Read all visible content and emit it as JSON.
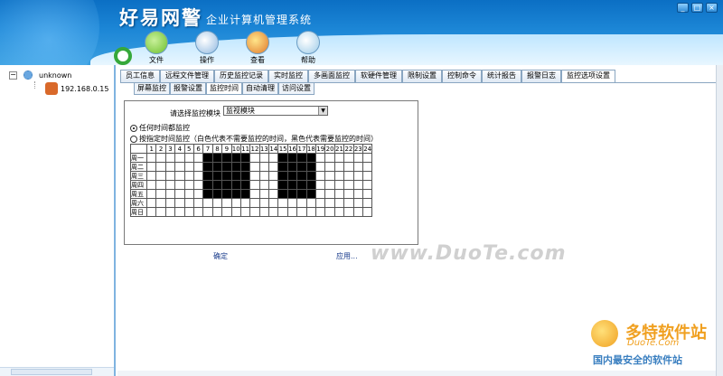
{
  "app": {
    "brand": "好易网警",
    "subtitle": "企业计算机管理系统",
    "window_buttons": [
      "_",
      "□",
      "×"
    ]
  },
  "toolbar": [
    {
      "label": "文件",
      "icon": "file-icon"
    },
    {
      "label": "操作",
      "icon": "operate-icon"
    },
    {
      "label": "查看",
      "icon": "view-icon"
    },
    {
      "label": "帮助",
      "icon": "help-icon"
    }
  ],
  "tree": {
    "root_label": "unknown",
    "child_label": "192.168.0.15",
    "expander": "−"
  },
  "tabs": [
    {
      "label": "员工信息",
      "active": false
    },
    {
      "label": "远程文件管理",
      "active": false
    },
    {
      "label": "历史监控记录",
      "active": false
    },
    {
      "label": "实时监控",
      "active": false
    },
    {
      "label": "多画面监控",
      "active": false
    },
    {
      "label": "软硬件管理",
      "active": false
    },
    {
      "label": "限制设置",
      "active": false
    },
    {
      "label": "控制命令",
      "active": false
    },
    {
      "label": "统计报告",
      "active": false
    },
    {
      "label": "报警日志",
      "active": false
    },
    {
      "label": "监控选项设置",
      "active": true
    }
  ],
  "subtabs": [
    {
      "label": "屏幕监控",
      "active": false
    },
    {
      "label": "报警设置",
      "active": false
    },
    {
      "label": "监控时间",
      "active": true
    },
    {
      "label": "自动清理",
      "active": false
    },
    {
      "label": "访问设置",
      "active": false
    }
  ],
  "panel": {
    "select_label": "请选择监控模块",
    "select_value": "监视模块",
    "radio_all": "任何时间都监控",
    "radio_scheduled": "按指定时间监控（白色代表不需要监控的时间，黑色代表需要监控的时间）",
    "radio_all_selected": true
  },
  "schedule": {
    "hours": [
      "1",
      "2",
      "3",
      "4",
      "5",
      "6",
      "7",
      "8",
      "9",
      "10",
      "11",
      "12",
      "13",
      "14",
      "15",
      "16",
      "17",
      "18",
      "19",
      "20",
      "21",
      "22",
      "23",
      "24"
    ],
    "days": [
      "周一",
      "周二",
      "周三",
      "周四",
      "周五",
      "周六",
      "周日"
    ],
    "black_ranges": [
      {
        "days": [
          1,
          2,
          3,
          4,
          5
        ],
        "hours": [
          7,
          8,
          9,
          10,
          11
        ]
      },
      {
        "days": [
          1,
          2,
          3,
          4,
          5
        ],
        "hours": [
          15,
          16,
          17,
          18
        ]
      }
    ]
  },
  "actions": {
    "confirm": "确定",
    "apply": "应用..."
  },
  "watermark": "www.DuoTe.com",
  "site_logo": {
    "name": "多特软件站",
    "url": "DuoTe.Com",
    "tagline": "国内最安全的软件站"
  },
  "colors": {
    "header_top": "#0b6fc4",
    "header_bottom": "#3a9fe0",
    "accent_green": "#36a83a",
    "link_blue": "#1a3c8c"
  }
}
